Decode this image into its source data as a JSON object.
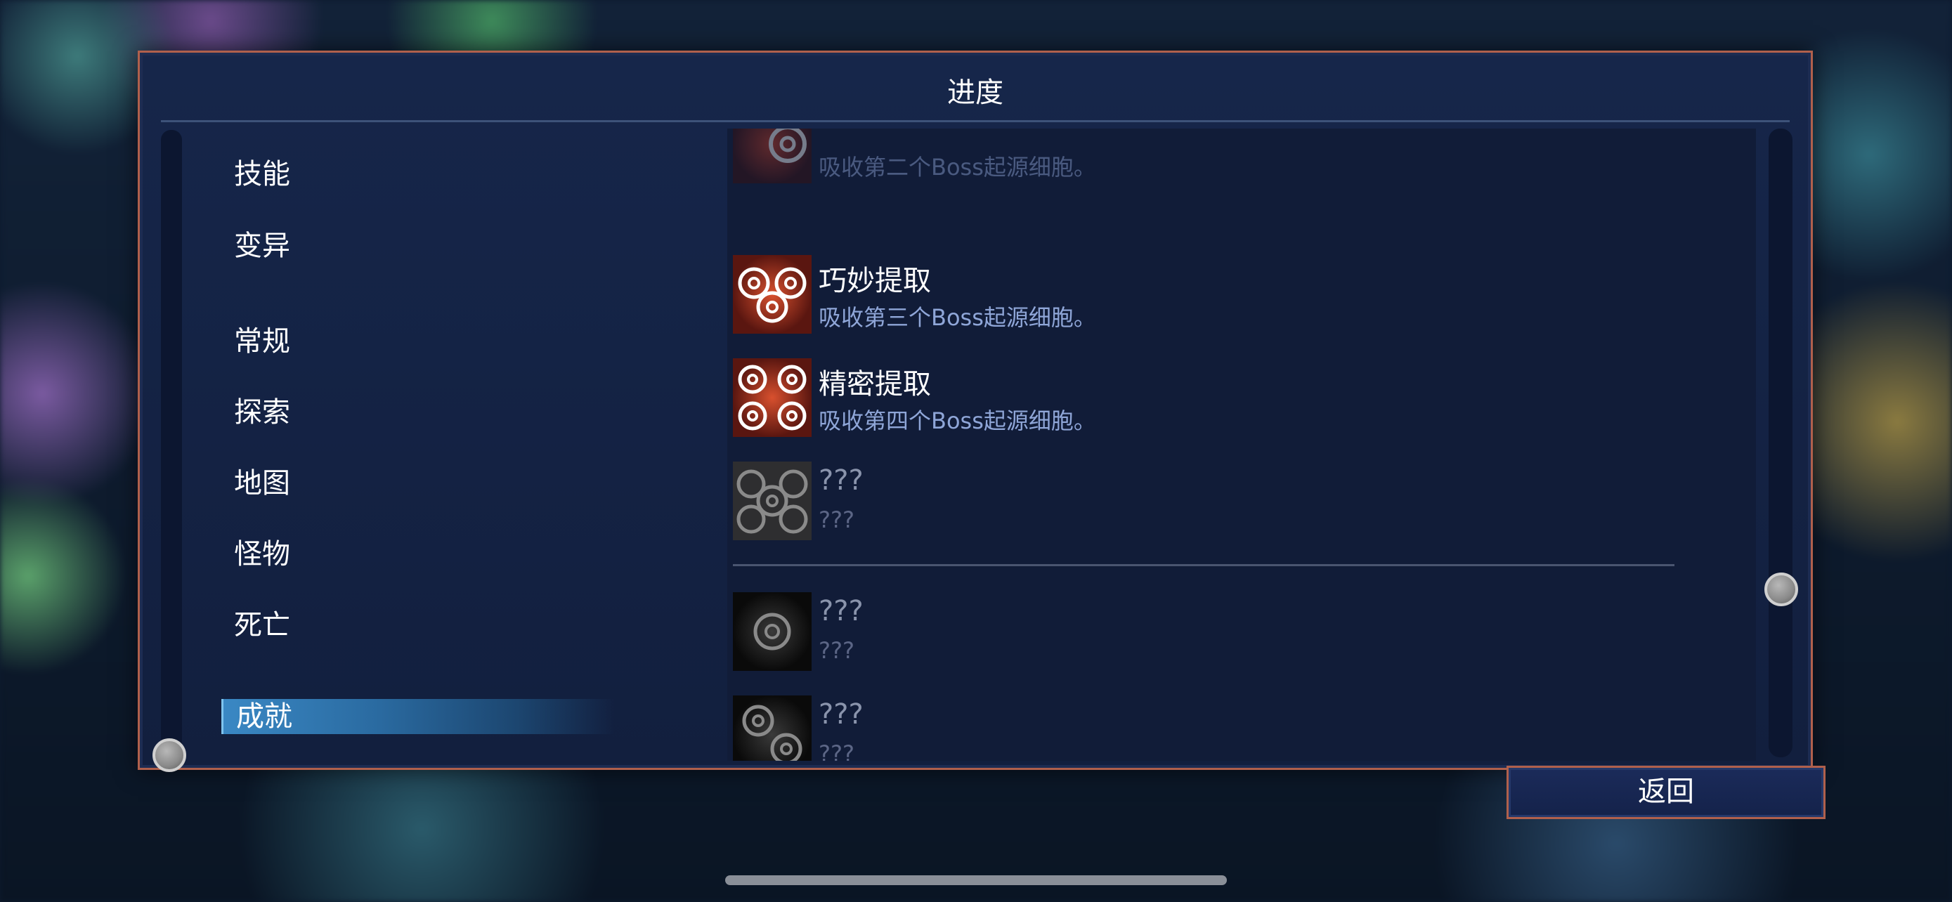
{
  "panel": {
    "title": "进度"
  },
  "nav": {
    "items": [
      {
        "label": "技能"
      },
      {
        "label": "变异"
      },
      {
        "label": "常规"
      },
      {
        "label": "探索"
      },
      {
        "label": "地图"
      },
      {
        "label": "怪物"
      },
      {
        "label": "死亡"
      },
      {
        "label": "成就",
        "active": true
      }
    ]
  },
  "entries": [
    {
      "name": "",
      "desc": "吸收第二个Boss起源细胞。",
      "icon": "red-origin-cell-icon",
      "state": "unlocked-partial"
    },
    {
      "name": "巧妙提取",
      "desc": "吸收第三个Boss起源细胞。",
      "icon": "red-origin-cell-icon",
      "state": "unlocked"
    },
    {
      "name": "精密提取",
      "desc": "吸收第四个Boss起源细胞。",
      "icon": "red-origin-cell-icon",
      "state": "unlocked"
    },
    {
      "name": "???",
      "desc": "???",
      "icon": "grey-origin-cell-icon",
      "state": "locked"
    },
    {
      "name": "???",
      "desc": "???",
      "icon": "grey-cell-icon",
      "state": "locked"
    },
    {
      "name": "???",
      "desc": "???",
      "icon": "grey-cell-icon",
      "state": "locked"
    }
  ],
  "back_button": {
    "label": "返回"
  },
  "colors": {
    "frame_border": "#b0604c",
    "active_tab": "#3a88c4",
    "desc_text": "#8fa6d8",
    "locked_text": "#5c6686"
  }
}
